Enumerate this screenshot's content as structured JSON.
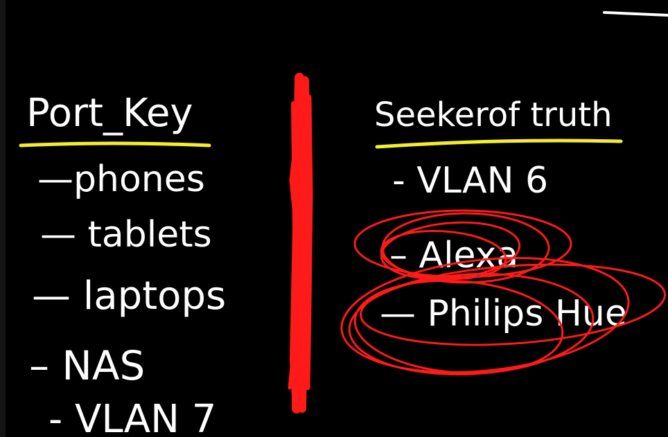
{
  "colors": {
    "background": "#000000",
    "ink": "#ffffff",
    "underline": "#f5ee2a",
    "scribble": "#ff1a1a"
  },
  "left_column": {
    "title": "Port_Key",
    "items": [
      "—phones",
      "— tablets",
      "— laptops",
      "– NAS",
      "- VLAN 7"
    ]
  },
  "right_column": {
    "title": "Seekerof truth",
    "items": [
      "- VLAN  6",
      "– Alexa",
      "— Philips Hue"
    ]
  }
}
